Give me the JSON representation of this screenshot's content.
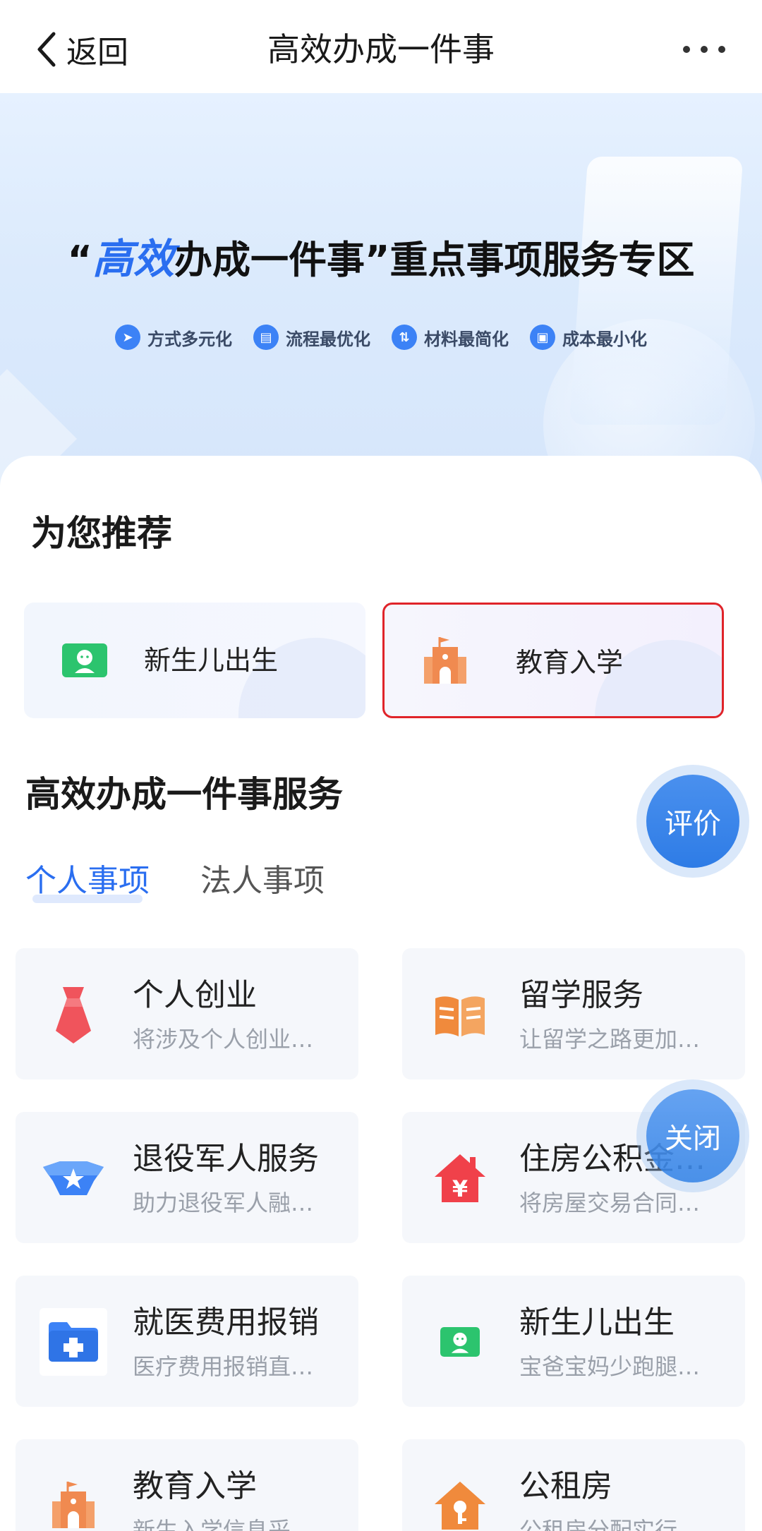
{
  "nav": {
    "back_label": "返回",
    "title": "高效办成一件事"
  },
  "banner": {
    "title_open": "“",
    "title_highlight": "高效",
    "title_rest": "办成一件事”重点事项服务专区",
    "chips": [
      {
        "label": "方式多元化",
        "icon": "paper-plane-icon"
      },
      {
        "label": "流程最优化",
        "icon": "document-icon"
      },
      {
        "label": "材料最简化",
        "icon": "flow-icon"
      },
      {
        "label": "成本最小化",
        "icon": "wallet-icon"
      }
    ]
  },
  "recommend": {
    "title": "为您推荐",
    "items": [
      {
        "label": "新生儿出生",
        "icon": "baby-icon"
      },
      {
        "label": "教育入学",
        "icon": "school-icon"
      }
    ]
  },
  "services": {
    "title": "高效办成一件事服务",
    "tabs": [
      "个人事项",
      "法人事项"
    ],
    "cards": [
      {
        "title": "个人创业",
        "desc": "将涉及个人创业…",
        "icon": "necktie-icon",
        "color": "#f0545c"
      },
      {
        "title": "留学服务",
        "desc": "让留学之路更加…",
        "icon": "book-icon",
        "color": "#f08a3c"
      },
      {
        "title": "退役军人服务",
        "desc": "助力退役军人融…",
        "icon": "star-badge-icon",
        "color": "#3c82f6"
      },
      {
        "title": "住房公积金…",
        "desc": "将房屋交易合同…",
        "icon": "house-yuan-icon",
        "color": "#f0414a"
      },
      {
        "title": "就医费用报销",
        "desc": "医疗费用报销直…",
        "icon": "medical-folder-icon",
        "color": "#3c82f6"
      },
      {
        "title": "新生儿出生",
        "desc": "宝爸宝妈少跑腿…",
        "icon": "baby-icon",
        "color": "#2cc46e"
      },
      {
        "title": "教育入学",
        "desc": "新生入学信息采…",
        "icon": "school-icon",
        "color": "#f08a50"
      },
      {
        "title": "公租房",
        "desc": "公租房分配实行…",
        "icon": "house-key-icon",
        "color": "#f08a3c"
      }
    ]
  },
  "fab": {
    "rate_label": "评价",
    "close_label": "关闭"
  },
  "colors": {
    "accent": "#2a6ef0",
    "highlight_border": "#e0242a"
  }
}
